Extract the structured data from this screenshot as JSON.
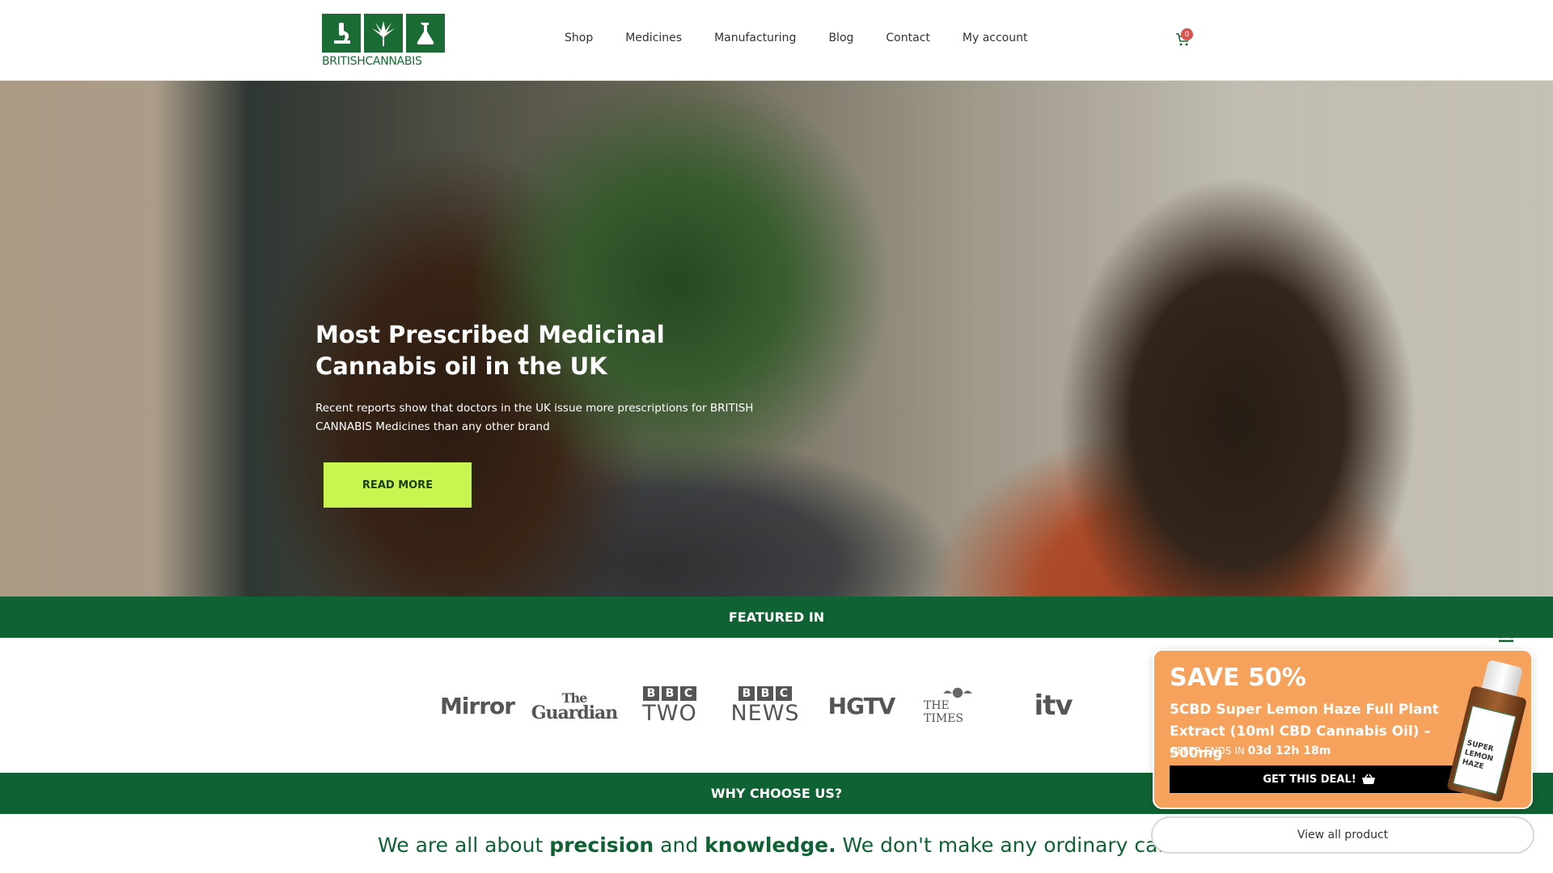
{
  "brand": {
    "logo_text": "BRITISHCANNABIS",
    "color": "#0f6233"
  },
  "nav": {
    "items": [
      {
        "label": "Shop"
      },
      {
        "label": "Medicines"
      },
      {
        "label": "Manufacturing"
      },
      {
        "label": "Blog"
      },
      {
        "label": "Contact"
      },
      {
        "label": "My account"
      }
    ],
    "cart_count": "0",
    "cart_icon": "cart-icon"
  },
  "hero": {
    "title": "Most Prescribed Medicinal Cannabis oil in the UK",
    "subtitle": "Recent reports show that doctors in the UK issue more prescriptions for BRITISH CANNABIS Medicines than any other brand",
    "button_label": "READ MORE",
    "button_color": "#c8f550"
  },
  "featured": {
    "heading": "FEATURED IN",
    "logos": {
      "mirror": "Mirror",
      "guardian_the": "The",
      "guardian": "Guardian",
      "bbc_b1": "B",
      "bbc_b2": "B",
      "bbc_c": "C",
      "bbc_two": "TWO",
      "bbc_news": "NEWS",
      "hgtv": "HGTV",
      "times": "THE TIMES",
      "itv": "itv"
    }
  },
  "why": {
    "heading": "WHY CHOOSE US?",
    "line1_a": "We are all about ",
    "line1_b": "precision",
    "line1_c": " and ",
    "line1_d": "knowledge.",
    "line1_e": " We don't make any ordinary cannab"
  },
  "popup": {
    "title": "SAVE 50%",
    "product": "5CBD Super Lemon Haze Full Plant Extract (10ml CBD Cannabis Oil) – 500mg",
    "offer_prefix": "OFFER ENDS IN ",
    "offer_time": "03d 12h 18m",
    "button_label": "GET THIS DEAL!",
    "bottle_label": "SUPER LEMON HAZE",
    "bg_color": "#f6a15c"
  },
  "view_all_label": "View all product"
}
